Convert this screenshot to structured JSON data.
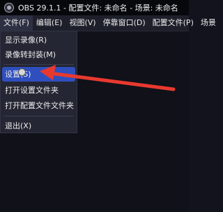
{
  "window": {
    "title": "OBS 29.1.1 - 配置文件: 未命名 - 场景: 未命名"
  },
  "menubar": {
    "items": [
      {
        "label": "文件(F)"
      },
      {
        "label": "编辑(E)"
      },
      {
        "label": "视图(V)"
      },
      {
        "label": "停靠窗口(D)"
      },
      {
        "label": "配置文件(P)"
      },
      {
        "label": "场景"
      }
    ]
  },
  "file_menu": {
    "items": [
      {
        "label": "显示录像(R)"
      },
      {
        "label": "录像转封装(M)"
      },
      {
        "label": "设置(S)"
      },
      {
        "label": "打开设置文件夹"
      },
      {
        "label": "打开配置文件文件夹"
      },
      {
        "label": "退出(X)"
      }
    ],
    "highlighted": "设置(S)"
  },
  "annotation": {
    "arrow_color": "#e8392f"
  }
}
